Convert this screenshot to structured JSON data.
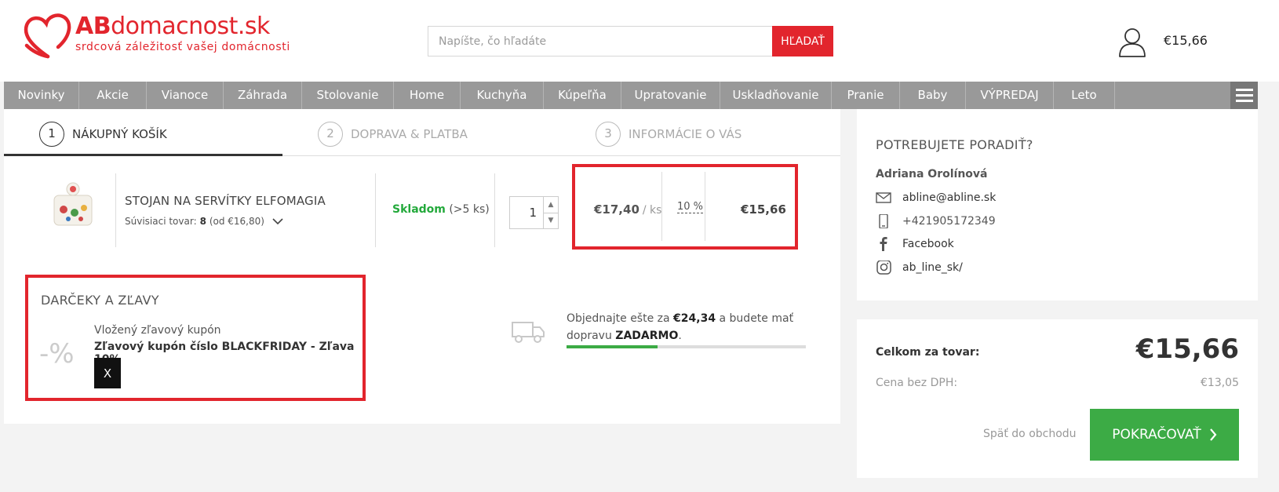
{
  "header": {
    "logo_name_bold": "AB",
    "logo_name_rest": "domacnost.sk",
    "logo_tagline": "srdcová záležitosť vašej domácnosti",
    "search_placeholder": "Napíšte, čo hľadáte",
    "search_button": "HĽADAŤ",
    "cart_total": "€15,66",
    "brand_color": "#e2252d"
  },
  "nav": {
    "items": [
      {
        "label": "Novinky"
      },
      {
        "label": "Akcie"
      },
      {
        "label": "Vianoce"
      },
      {
        "label": "Záhrada"
      },
      {
        "label": "Stolovanie"
      },
      {
        "label": "Home"
      },
      {
        "label": "Kuchyňa"
      },
      {
        "label": "Kúpeľňa"
      },
      {
        "label": "Upratovanie"
      },
      {
        "label": "Uskladňovanie"
      },
      {
        "label": "Pranie"
      },
      {
        "label": "Baby"
      },
      {
        "label": "VÝPREDAJ"
      },
      {
        "label": "Leto"
      }
    ]
  },
  "steps": [
    {
      "num": "1",
      "label": "NÁKUPNÝ KOŠÍK"
    },
    {
      "num": "2",
      "label": "DOPRAVA & PLATBA"
    },
    {
      "num": "3",
      "label": "INFORMÁCIE O VÁS"
    }
  ],
  "product": {
    "name": "STOJAN NA SERVÍTKY ELFOMAGIA",
    "related_label": "Súvisiaci tovar:",
    "related_count": "8",
    "related_from": "(od €16,80)",
    "stock_label": "Skladom",
    "stock_qty": "(>5 ks)",
    "quantity": "1",
    "unit_price": "€17,40",
    "unit_suffix": "/ ks",
    "discount": "10 %",
    "line_total": "€15,66"
  },
  "gifts": {
    "title": "DARČEKY A ZĽAVY",
    "icon_text": "-%",
    "coupon_label": "Vložený zľavový kupón",
    "coupon_name": "Zľavový kupón číslo BLACKFRIDAY - Zľava 10%",
    "remove_label": "X"
  },
  "shipping": {
    "text_before": "Objednajte ešte za",
    "amount": "€24,34",
    "text_middle": "a budete mať dopravu",
    "free": "ZADARMO",
    "text_end": ".",
    "progress_fraction": 0.38
  },
  "advice": {
    "title": "POTREBUJETE PORADIŤ?",
    "advisor": "Adriana Orolínová",
    "email": "abline@abline.sk",
    "phone": "+421905172349",
    "facebook": "Facebook",
    "instagram": "ab_line_sk/"
  },
  "summary": {
    "total_label": "Celkom za tovar:",
    "total_value": "€15,66",
    "vat_label": "Cena bez DPH:",
    "vat_value": "€13,05",
    "back_label": "Späť do obchodu",
    "continue_label": "POKRAČOVAŤ"
  }
}
